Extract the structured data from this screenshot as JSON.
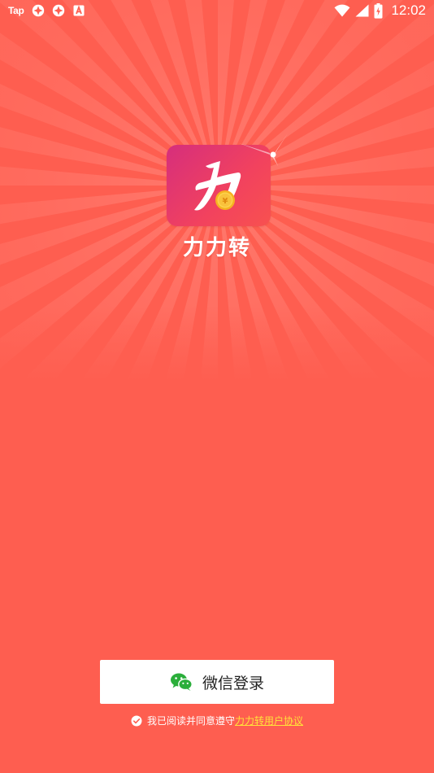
{
  "status_bar": {
    "left_label": "Tap",
    "time": "12:02",
    "icons": [
      "tap-app-icon",
      "game-app-icon",
      "game-app-icon-2",
      "accessibility-app-icon",
      "wifi-icon",
      "signal-icon",
      "battery-icon"
    ]
  },
  "splash": {
    "app_icon": "li-coin-logo-icon",
    "app_name": "力力转"
  },
  "login": {
    "button_icon": "wechat-icon",
    "button_label": "微信登录"
  },
  "agreement": {
    "prefix": "我已阅读并同意遵守",
    "link_text": "力力转用户协议",
    "checked": true
  },
  "colors": {
    "background": "#fe5e50",
    "ray": "#ff6f62",
    "link": "#ffe23a",
    "wechat_green": "#2aae3a",
    "icon_gradient": [
      "#d62e7c",
      "#f8514f"
    ]
  }
}
